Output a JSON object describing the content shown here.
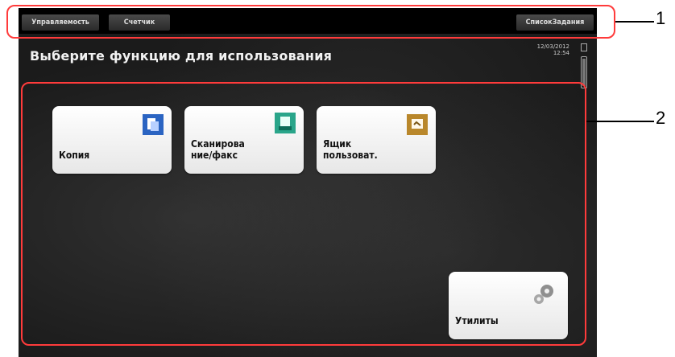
{
  "topbar": {
    "tab_management": "Управляемость",
    "tab_counter": "Счетчик",
    "tab_job_list": "СписокЗадания"
  },
  "screen": {
    "title": "Выберите функцию для использования",
    "date": "12/03/2012",
    "time": "12:54"
  },
  "tiles": {
    "copy": {
      "label": "Копия",
      "icon": "copy-icon"
    },
    "scan_fax": {
      "label": "Сканирова ние/факс",
      "icon": "scan-fax-icon"
    },
    "user_box": {
      "label": "Ящик пользоват.",
      "icon": "user-box-icon"
    },
    "utilities": {
      "label": "Утилиты",
      "icon": "gear-icon"
    }
  },
  "annotations": {
    "callout_1": "1",
    "callout_2": "2",
    "color": "#ff3b3b"
  }
}
